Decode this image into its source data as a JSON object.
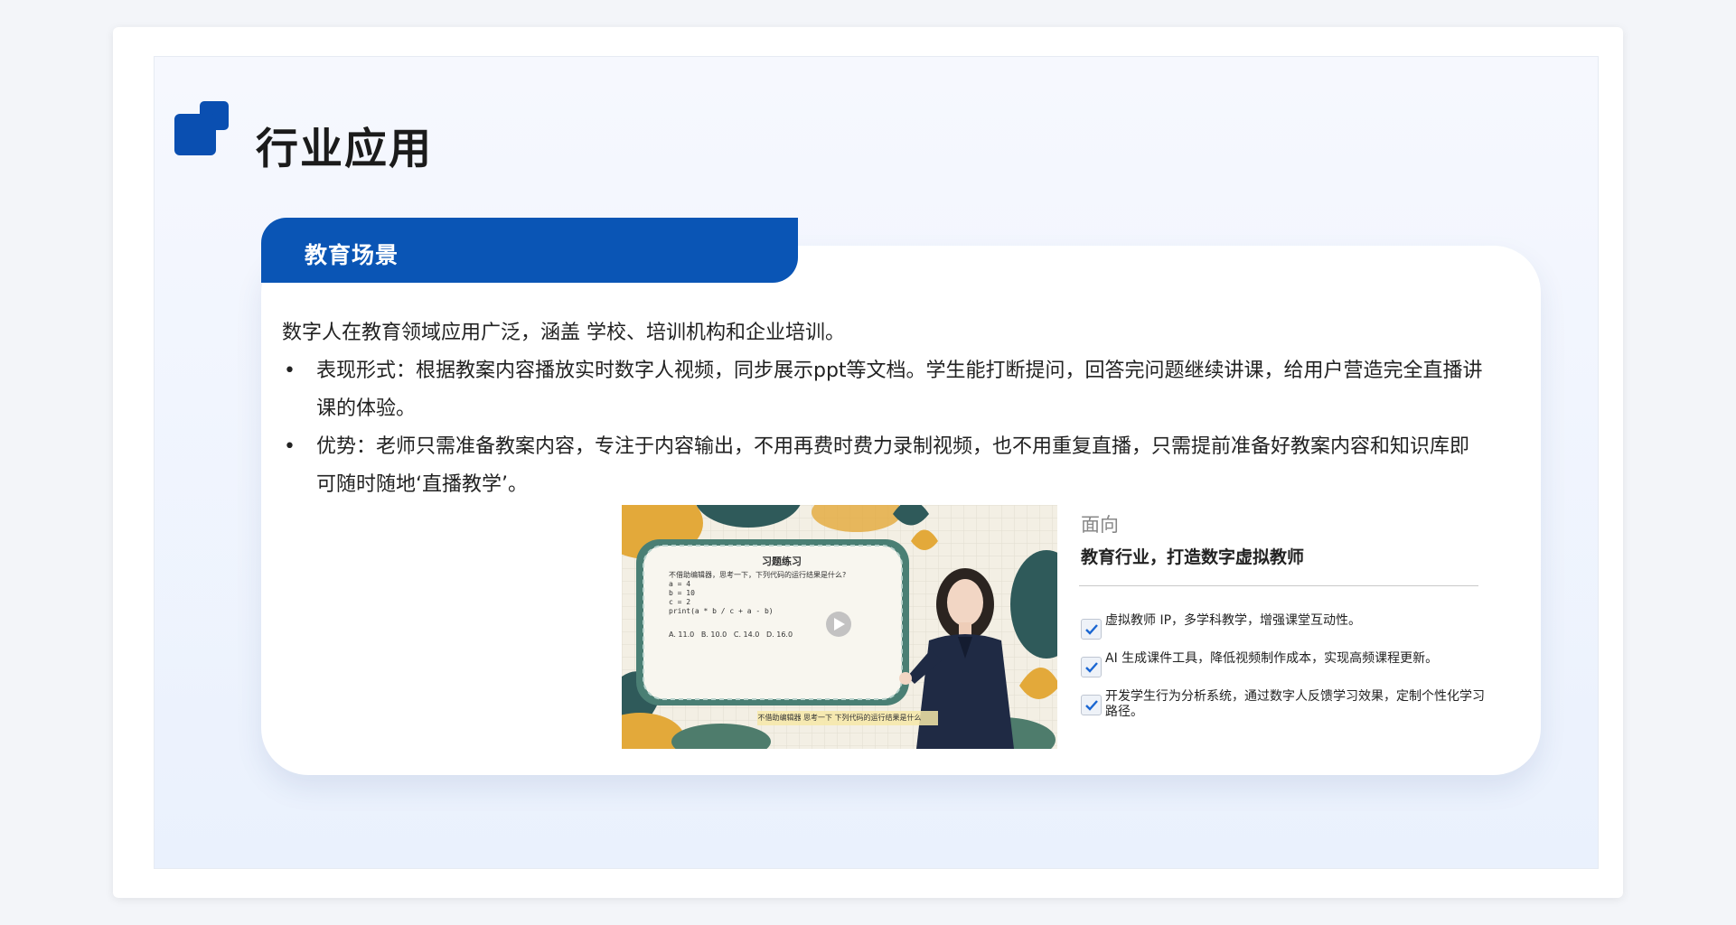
{
  "page": {
    "title": "行业应用"
  },
  "section": {
    "tab_label": "教育场景",
    "intro": "数字人在教育领域应用广泛，涵盖 学校、培训机构和企业培训。",
    "bullets": [
      {
        "marker": "•",
        "text": "表现形式：根据教案内容播放实时数字人视频，同步展示ppt等文档。学生能打断提问，回答完问题继续讲课，给用户营造完全直播讲课的体验。"
      },
      {
        "marker": "•",
        "text": "优势：老师只需准备教案内容，专注于内容输出，不用再费时费力录制视频，也不用重复直播，只需提前准备好教案内容和知识库即可随时随地‘直播教学’。"
      }
    ]
  },
  "video": {
    "board_title": "习题练习",
    "question": "不借助编辑器，思考一下，下列代码的运行结果是什么?",
    "code": [
      "a = 4",
      "b = 10",
      "c = 2",
      "print(a * b / c + a - b)"
    ],
    "options": "A. 11.0   B. 10.0   C. 14.0   D. 16.0",
    "subtitle": "不借助编辑器 思考一下 下列代码的运行结果是什么"
  },
  "side": {
    "title": "面向",
    "subtitle": "教育行业，打造数字虚拟教师",
    "features": [
      "虚拟教师 IP，多学科教学，增强课堂互动性。",
      "AI 生成课件工具，降低视频制作成本，实现高频课程更新。",
      "开发学生行为分析系统，通过数字人反馈学习效果，定制个性化学习路径。"
    ]
  },
  "colors": {
    "brand_blue": "#0a55b5",
    "logo_blue": "#0a4fb1",
    "check_blue": "#1a66d2"
  },
  "icons": {
    "logo": "overlapping-squares-logo",
    "check": "check-icon",
    "play": "play-icon"
  }
}
